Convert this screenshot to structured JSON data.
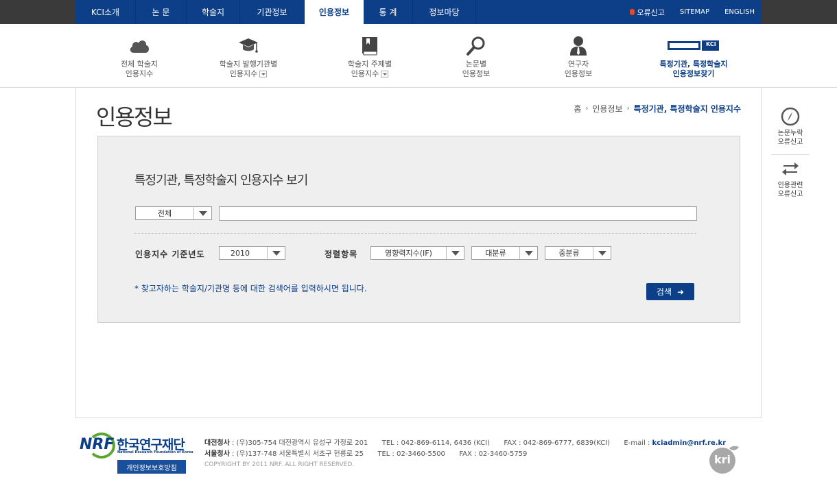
{
  "topnav": {
    "items": [
      {
        "label": "KCI소개",
        "width": 88
      },
      {
        "label": "논 문",
        "width": 74
      },
      {
        "label": "학술지",
        "width": 78
      },
      {
        "label": "기관정보",
        "width": 94
      },
      {
        "label": "인용정보",
        "width": 86,
        "active": true
      },
      {
        "label": "통 계",
        "width": 72
      },
      {
        "label": "정보마당",
        "width": 92
      }
    ],
    "report": "오류신고",
    "sitemap": "SITEMAP",
    "english": "ENGLISH"
  },
  "subnav": {
    "items": [
      {
        "line1": "전체 학술지",
        "line2": "인용지수",
        "icon": "cloud-icon"
      },
      {
        "line1": "학술지 발행기관별",
        "line2": "인용지수",
        "icon": "graduation-cap-icon",
        "dropdown": true
      },
      {
        "line1": "학술지 주제별",
        "line2": "인용지수",
        "icon": "book-icon",
        "dropdown": true
      },
      {
        "line1": "논문별",
        "line2": "인용정보",
        "icon": "magnifier-icon"
      },
      {
        "line1": "연구자",
        "line2": "인용정보",
        "icon": "person-icon"
      },
      {
        "line1": "특정기관, 특정학술지",
        "line2": "인용정보찾기",
        "icon": "kci-search-icon",
        "active": true
      }
    ],
    "kci_badge": "KCI"
  },
  "page": {
    "title": "인용정보",
    "breadcrumb": {
      "home": "홈",
      "level1": "인용정보",
      "current": "특정기관, 특정학술지 인용지수"
    }
  },
  "panel": {
    "title": "특정기관, 특정학술지 인용지수 보기",
    "scope_select": "전체",
    "search_value": "",
    "year_label": "인용지수 기준년도",
    "year_select": "2010",
    "sort_label": "정렬항목",
    "sort_select": "영향력지수(IF)",
    "major_select": "대분류",
    "minor_select": "중분류",
    "hint": "* 찾고자하는 학술지/기관명 등에 대한 검색어를 입력하시면 됩니다.",
    "search_button": "검색"
  },
  "side": {
    "item1": {
      "line1": "논문누락",
      "line2": "오류신고"
    },
    "item2": {
      "line1": "인용관련",
      "line2": "오류신고"
    }
  },
  "footer": {
    "logo_text": "NRF",
    "org_name": "한국연구재단",
    "org_sub": "National Research Foundation of Korea",
    "privacy": "개인정보보호방침",
    "line1": {
      "label": "대전청사",
      "address": ": (우)305-754 대전광역시 유성구 가정로 201",
      "tel": "TEL : 042-869-6114, 6436 (KCI)",
      "fax": "FAX : 042-869-6777, 6839(KCI)",
      "email_label": "E-mail :",
      "email": "kciadmin@nrf.re.kr"
    },
    "line2": {
      "label": "서울청사",
      "address": ": (우)137-748 서울특별시 서초구 헌릉로 25",
      "tel": "TEL : 02-3460-5500",
      "fax": "FAX : 02-3460-5759"
    },
    "copyright": "COPYRIGHT BY 2011 NRF. ALL RIGHT RESERVED.",
    "kri": "kri"
  }
}
